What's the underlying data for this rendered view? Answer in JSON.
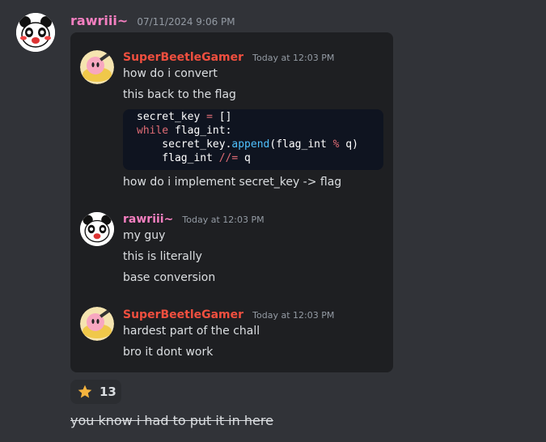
{
  "message": {
    "author": "rawriii~",
    "timestamp": "07/11/2024 9:06 PM",
    "author_color": "#f47fc0"
  },
  "quoted": {
    "messages": [
      {
        "author": "SuperBeetleGamer",
        "author_color": "#f04f3f",
        "timestamp": "Today at 12:03 PM",
        "lines": [
          "how do i convert",
          "this back to the flag"
        ],
        "code": {
          "lines": [
            "secret_key = []",
            "while flag_int:",
            "    secret_key.append(flag_int % q)",
            "    flag_int //= q"
          ]
        },
        "after_code": "how do i implement secret_key -> flag"
      },
      {
        "author": "rawriii~",
        "author_color": "#f47fc0",
        "timestamp": "Today at 12:03 PM",
        "lines": [
          "my guy",
          "this is literally",
          "base conversion"
        ]
      },
      {
        "author": "SuperBeetleGamer",
        "author_color": "#f04f3f",
        "timestamp": "Today at 12:03 PM",
        "lines": [
          "hardest part of the chall",
          "bro it dont work"
        ]
      }
    ]
  },
  "reaction": {
    "emoji": "star-icon",
    "count": "13"
  },
  "strikethrough_text": "you know i had to put it in here"
}
